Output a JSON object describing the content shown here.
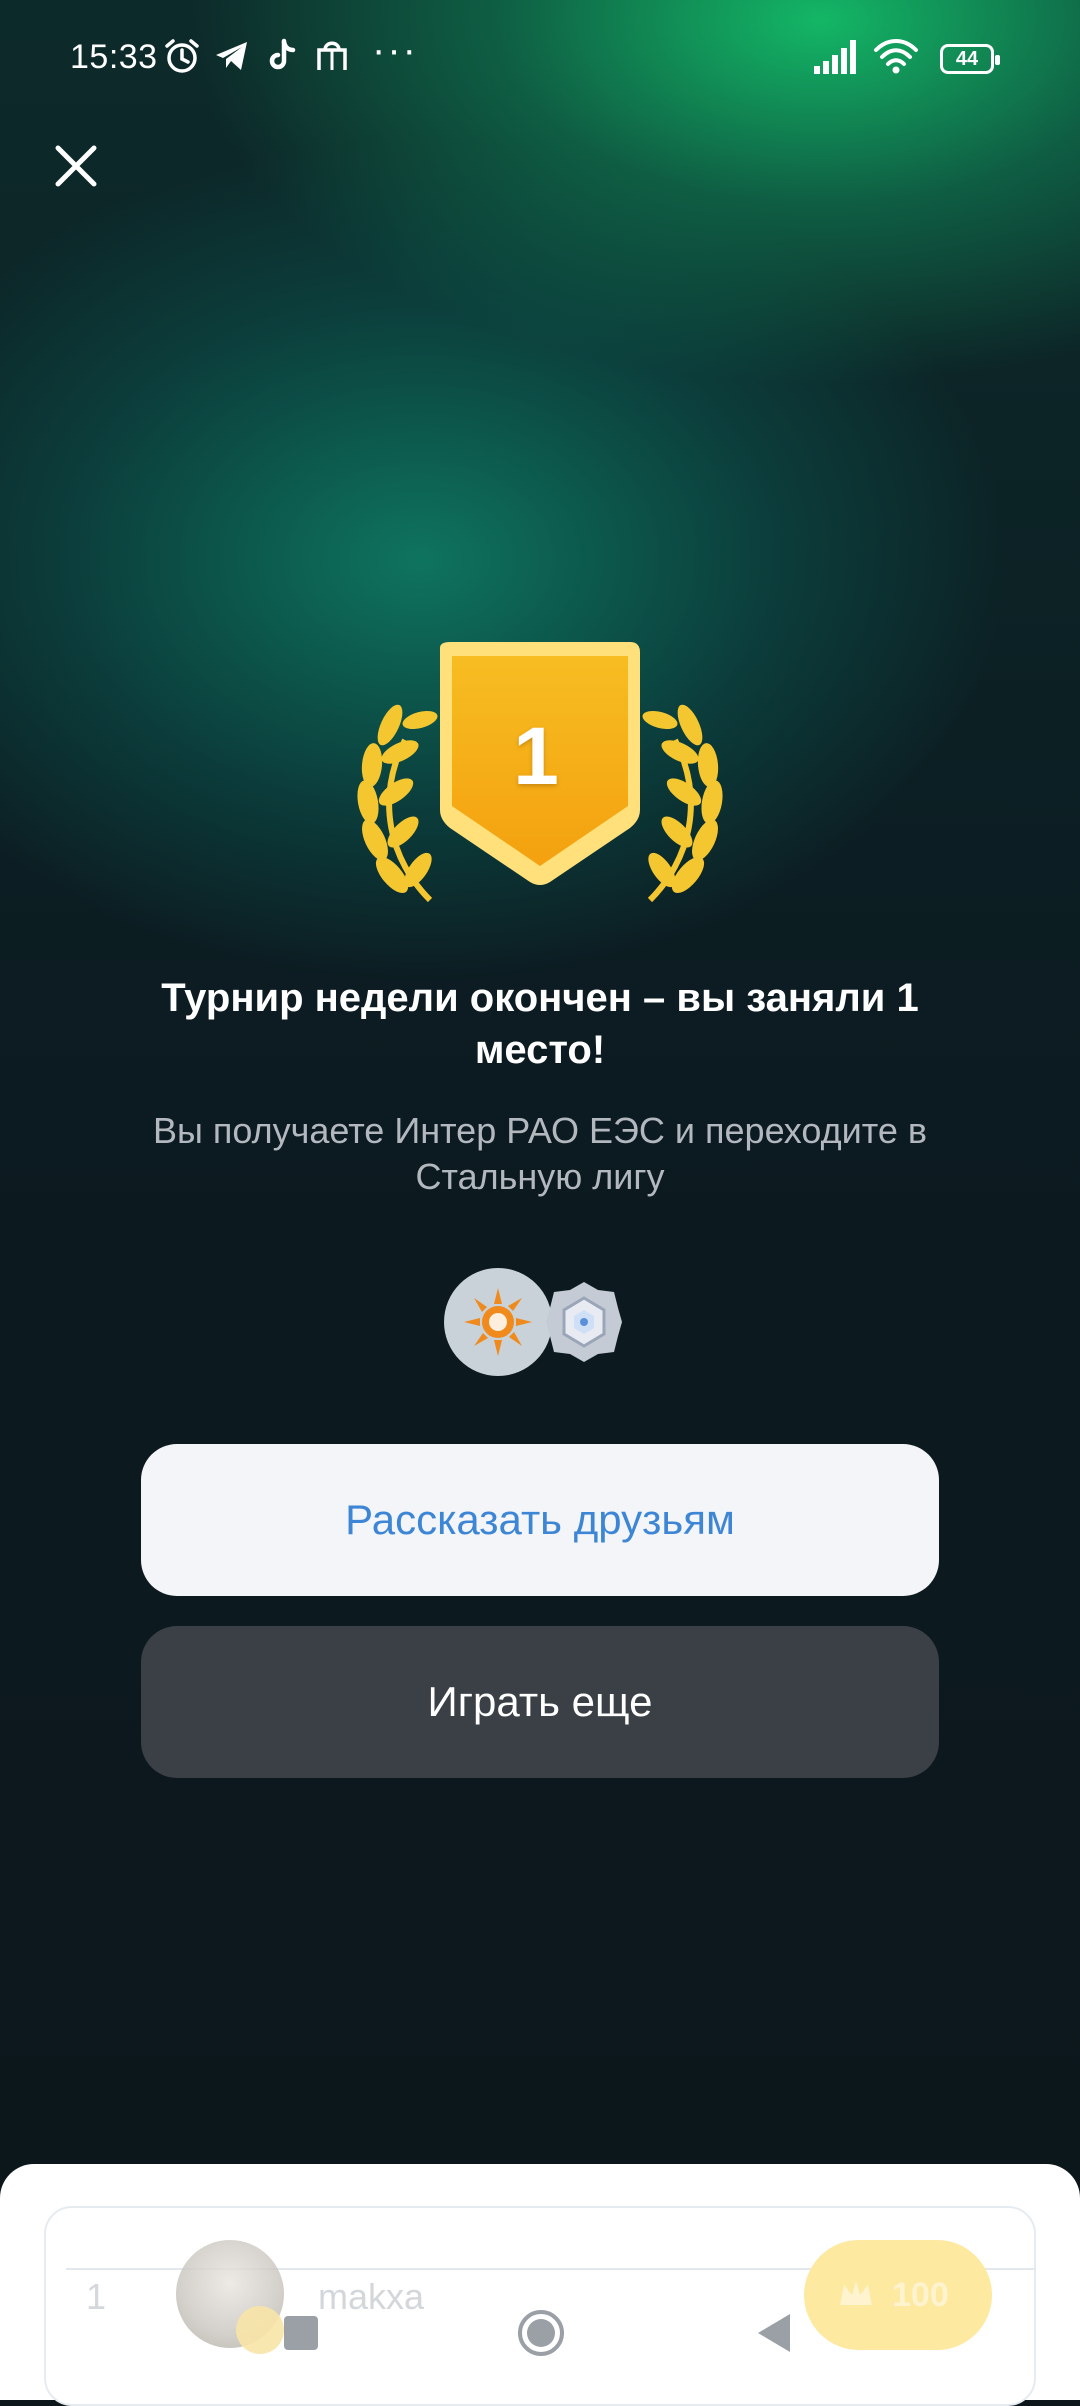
{
  "status_bar": {
    "time": "15:33",
    "icons": [
      "alarm-icon",
      "telegram-icon",
      "tiktok-icon",
      "shopping-bag-icon",
      "more-dots-icon",
      "signal-icon",
      "wifi-icon",
      "battery-icon"
    ],
    "overflow": "···",
    "battery_level": "44"
  },
  "header": {
    "close_icon": "close-icon"
  },
  "result": {
    "place": "1",
    "title": "Турнир недели окончен – вы заняли 1 место!",
    "subtitle": "Вы получаете Интер РАО ЕЭС и переходите в Стальную лигу"
  },
  "rewards": {
    "items": [
      "company-logo-icon",
      "steel-league-badge-icon"
    ]
  },
  "buttons": {
    "share_label": "Рассказать друзьям",
    "play_label": "Играть еще"
  },
  "leaderboard": {
    "rows": [
      {
        "rank": "1",
        "name": "makxa",
        "score": "100"
      }
    ]
  },
  "colors": {
    "accent_blue": "#3d86d6",
    "gold": "#f6b71c",
    "share_bg": "#f3f5f8",
    "play_bg": "#3a4045"
  }
}
